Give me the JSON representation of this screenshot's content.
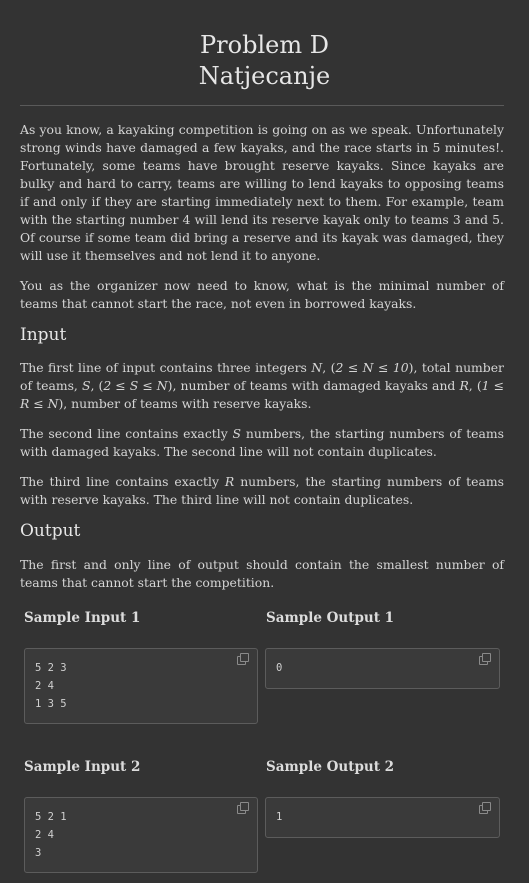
{
  "title": {
    "line1": "Problem D",
    "line2": "Natjecanje"
  },
  "statement": {
    "p1": "As you know, a kayaking competition is going on as we speak. Unfortunately strong winds have damaged a few kayaks, and the race starts in 5 minutes!. Fortunately, some teams have brought reserve kayaks. Since kayaks are bulky and hard to carry, teams are willing to lend kayaks to opposing teams if and only if they are starting immediately next to them. For example, team with the starting number 4 will lend its reserve kayak only to teams 3 and 5. Of course if some team did bring a reserve and its kayak was damaged, they will use it themselves and not lend it to anyone.",
    "p2": "You as the organizer now need to know, what is the minimal number of teams that cannot start the race, not even in borrowed kayaks."
  },
  "input": {
    "heading": "Input",
    "p1_pre": "The first line of input contains three integers ",
    "p1_N": "N",
    "p1_c1": ", (",
    "p1_r1": "2 ≤ N ≤ 10",
    "p1_c2": "), total number of teams, ",
    "p1_S": "S",
    "p1_c3": ", (",
    "p1_r2": "2 ≤ S ≤ N",
    "p1_c4": "), number of teams with damaged kayaks and ",
    "p1_R": "R",
    "p1_c5": ", (",
    "p1_r3": "1 ≤ R ≤ N",
    "p1_c6": "), number of teams with reserve kayaks.",
    "p2_pre": "The second line contains exactly ",
    "p2_S": "S",
    "p2_post": " numbers, the starting numbers of teams with damaged kayaks. The second line will not contain duplicates.",
    "p3_pre": "The third line contains exactly ",
    "p3_R": "R",
    "p3_post": " numbers, the starting numbers of teams with reserve kayaks. The third line will not contain duplicates."
  },
  "output": {
    "heading": "Output",
    "p1": "The first and only line of output should contain the smallest number of teams that cannot start the competition."
  },
  "samples": [
    {
      "input_label": "Sample Input 1",
      "output_label": "Sample Output 1",
      "input_lines": [
        "5 2 3",
        "2 4",
        "1 3 5"
      ],
      "output_lines": [
        "0"
      ]
    },
    {
      "input_label": "Sample Input 2",
      "output_label": "Sample Output 2",
      "input_lines": [
        "5 2 1",
        "2 4",
        "3"
      ],
      "output_lines": [
        "1"
      ]
    }
  ],
  "icons": {
    "copy": "copy-icon"
  }
}
